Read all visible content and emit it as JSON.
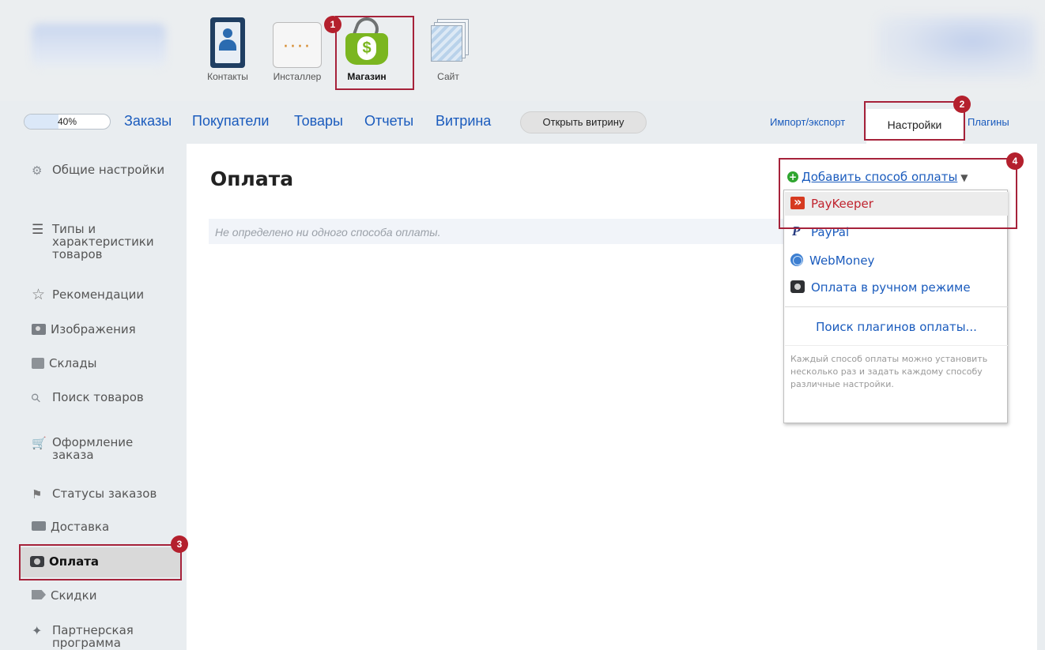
{
  "apps": [
    {
      "label": "Контакты"
    },
    {
      "label": "Инсталлер"
    },
    {
      "label": "Магазин"
    },
    {
      "label": "Сайт"
    }
  ],
  "progress": {
    "text": "40%",
    "value": 0.4
  },
  "nav": {
    "links": [
      "Заказы",
      "Покупатели",
      "Товары",
      "Отчеты",
      "Витрина"
    ],
    "open_storefront": "Открыть витрину",
    "import_export": "Импорт/экспорт",
    "settings": "Настройки",
    "plugins": "Плагины"
  },
  "badges": [
    "1",
    "2",
    "3",
    "4"
  ],
  "sidebar": {
    "items": [
      {
        "label": "Общие настройки",
        "icon": "gears-icon"
      },
      {
        "label": "Типы и характеристики товаров",
        "icon": "list-icon"
      },
      {
        "label": "Рекомендации",
        "icon": "star-icon"
      },
      {
        "label": "Изображения",
        "icon": "camera-icon"
      },
      {
        "label": "Склады",
        "icon": "box-icon"
      },
      {
        "label": "Поиск товаров",
        "icon": "search-icon"
      },
      {
        "label": "Оформление заказа",
        "icon": "cart-icon"
      },
      {
        "label": "Статусы заказов",
        "icon": "flag-icon"
      },
      {
        "label": "Доставка",
        "icon": "truck-icon"
      },
      {
        "label": "Оплата",
        "icon": "money-icon"
      },
      {
        "label": "Скидки",
        "icon": "tag-icon"
      },
      {
        "label": "Партнерская программа",
        "icon": "ribbon-icon"
      }
    ]
  },
  "main": {
    "title": "Оплата",
    "empty_message": "Не определено ни одного способа оплаты.",
    "add_payment": "Добавить способ оплаты"
  },
  "dropdown": {
    "methods": [
      "PayKeeper",
      "PayPal",
      "WebMoney",
      "Оплата в ручном режиме"
    ],
    "search_plugins": "Поиск плагинов оплаты...",
    "hint": "Каждый способ оплаты можно установить несколько раз и задать каждому способу различные настройки."
  },
  "colors": {
    "link": "#1a5bbd",
    "highlight_box": "#a6223a",
    "badge": "#b4202d",
    "accent_green": "#7bb620"
  }
}
